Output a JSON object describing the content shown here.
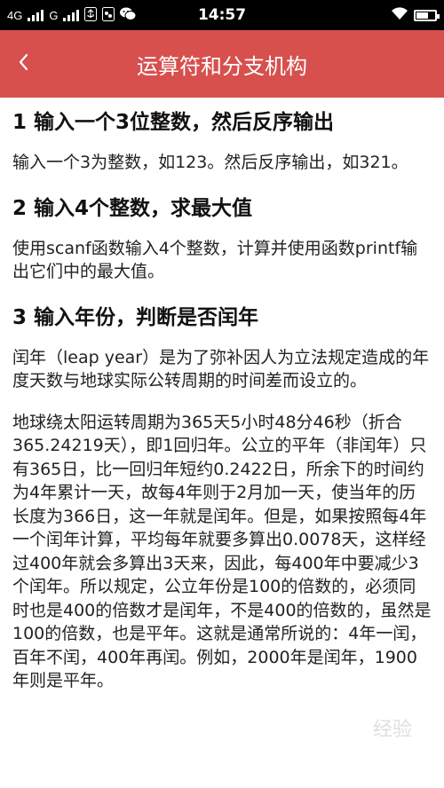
{
  "status_bar": {
    "network_1": "4G",
    "network_2": "G",
    "time": "14:57"
  },
  "header": {
    "title": "运算符和分支机构"
  },
  "sections": [
    {
      "heading": "1 输入一个3位整数，然后反序输出",
      "paragraphs": [
        "输入一个3为整数，如123。然后反序输出，如321。"
      ]
    },
    {
      "heading": "2 输入4个整数，求最大值",
      "paragraphs": [
        "使用scanf函数输入4个整数，计算并使用函数printf输出它们中的最大值。"
      ]
    },
    {
      "heading": "3 输入年份，判断是否闰年",
      "paragraphs": [
        "闰年（leap year）是为了弥补因人为立法规定造成的年度天数与地球实际公转周期的时间差而设立的。",
        "地球绕太阳运转周期为365天5小时48分46秒（折合365.24219天），即1回归年。公立的平年（非闰年）只有365日，比一回归年短约0.2422日，所余下的时间约为4年累计一天，故每4年则于2月加一天，使当年的历长度为366日，这一年就是闰年。但是，如果按照每4年一个闰年计算，平均每年就要多算出0.0078天，这样经过400年就会多算出3天来，因此，每400年中要减少3个闰年。所以规定，公立年份是100的倍数的，必须同时也是400的倍数才是闰年，不是400的倍数的，虽然是100的倍数，也是平年。这就是通常所说的：4年一闰，百年不闰，400年再闰。例如，2000年是闰年，1900年则是平年。"
      ]
    }
  ],
  "watermark": "经验"
}
